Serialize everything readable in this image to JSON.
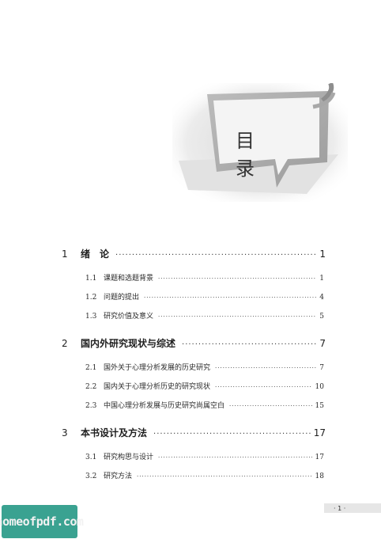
{
  "heading": {
    "title": "目 录"
  },
  "toc": [
    {
      "type": "chapter",
      "num": "1",
      "label": "绪　论",
      "page": "1"
    },
    {
      "type": "section",
      "num": "1.1",
      "label": "课题和选题背景",
      "page": "1"
    },
    {
      "type": "section",
      "num": "1.2",
      "label": "问题的提出",
      "page": "4"
    },
    {
      "type": "section",
      "num": "1.3",
      "label": "研究价值及意义",
      "page": "5"
    },
    {
      "type": "chapter",
      "num": "2",
      "label": "国内外研究现状与综述",
      "page": "7"
    },
    {
      "type": "section",
      "num": "2.1",
      "label": "国外关于心理分析发展的历史研究",
      "page": "7"
    },
    {
      "type": "section",
      "num": "2.2",
      "label": "国内关于心理分析历史的研究现状",
      "page": "10"
    },
    {
      "type": "section",
      "num": "2.3",
      "label": "中国心理分析发展与历史研究尚属空白",
      "page": "15"
    },
    {
      "type": "chapter",
      "num": "3",
      "label": "本书设计及方法",
      "page": "17"
    },
    {
      "type": "section",
      "num": "3.1",
      "label": "研究构思与设计",
      "page": "17"
    },
    {
      "type": "section",
      "num": "3.2",
      "label": "研究方法",
      "page": "18"
    }
  ],
  "footer": {
    "page_number": "· 1 ·"
  },
  "watermark": {
    "text": "homeofpdf.com"
  }
}
